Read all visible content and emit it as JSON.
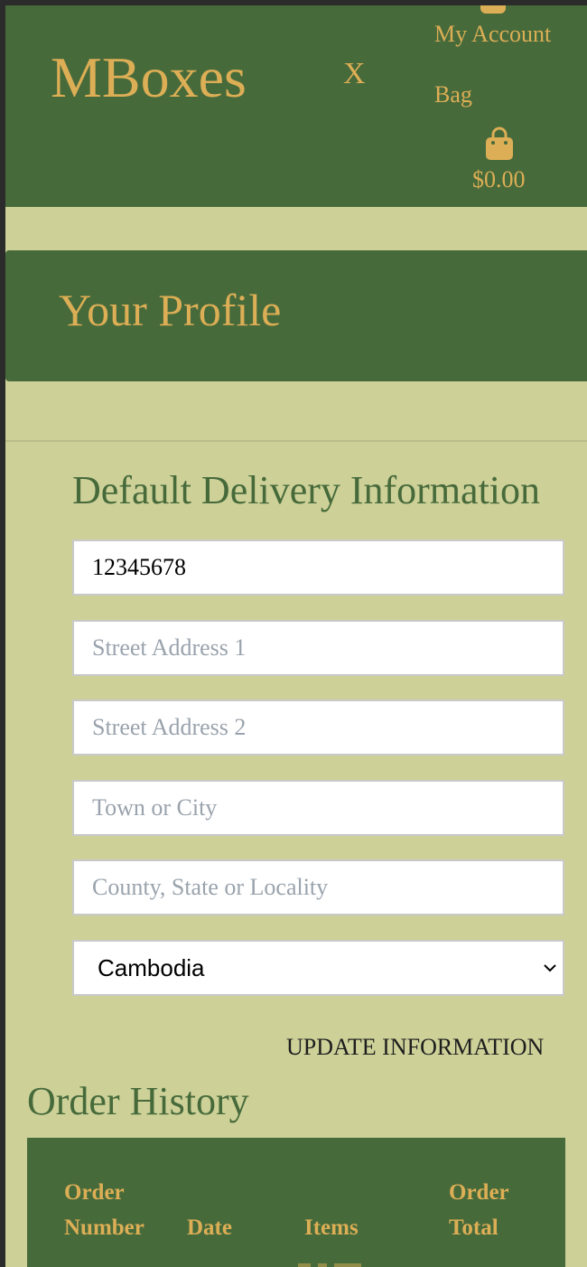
{
  "header": {
    "brand": "MBoxes",
    "close_label": "X",
    "my_account_label": "My Account",
    "bag_label": "Bag",
    "bag_total": "$0.00"
  },
  "profile": {
    "title": "Your Profile"
  },
  "delivery": {
    "heading": "Default Delivery Information",
    "phone_value": "12345678",
    "street1_placeholder": "Street Address 1",
    "street2_placeholder": "Street Address 2",
    "town_placeholder": "Town or City",
    "county_placeholder": "County, State or Locality",
    "country_value": "Cambodia",
    "update_label": "UPDATE INFORMATION"
  },
  "orders": {
    "heading": "Order History",
    "columns": [
      "Order Number",
      "Date",
      "Items",
      "Order Total"
    ]
  },
  "colors": {
    "header_green": "#476a3b",
    "page_background": "#cdd198",
    "accent_gold": "#dcae55"
  }
}
